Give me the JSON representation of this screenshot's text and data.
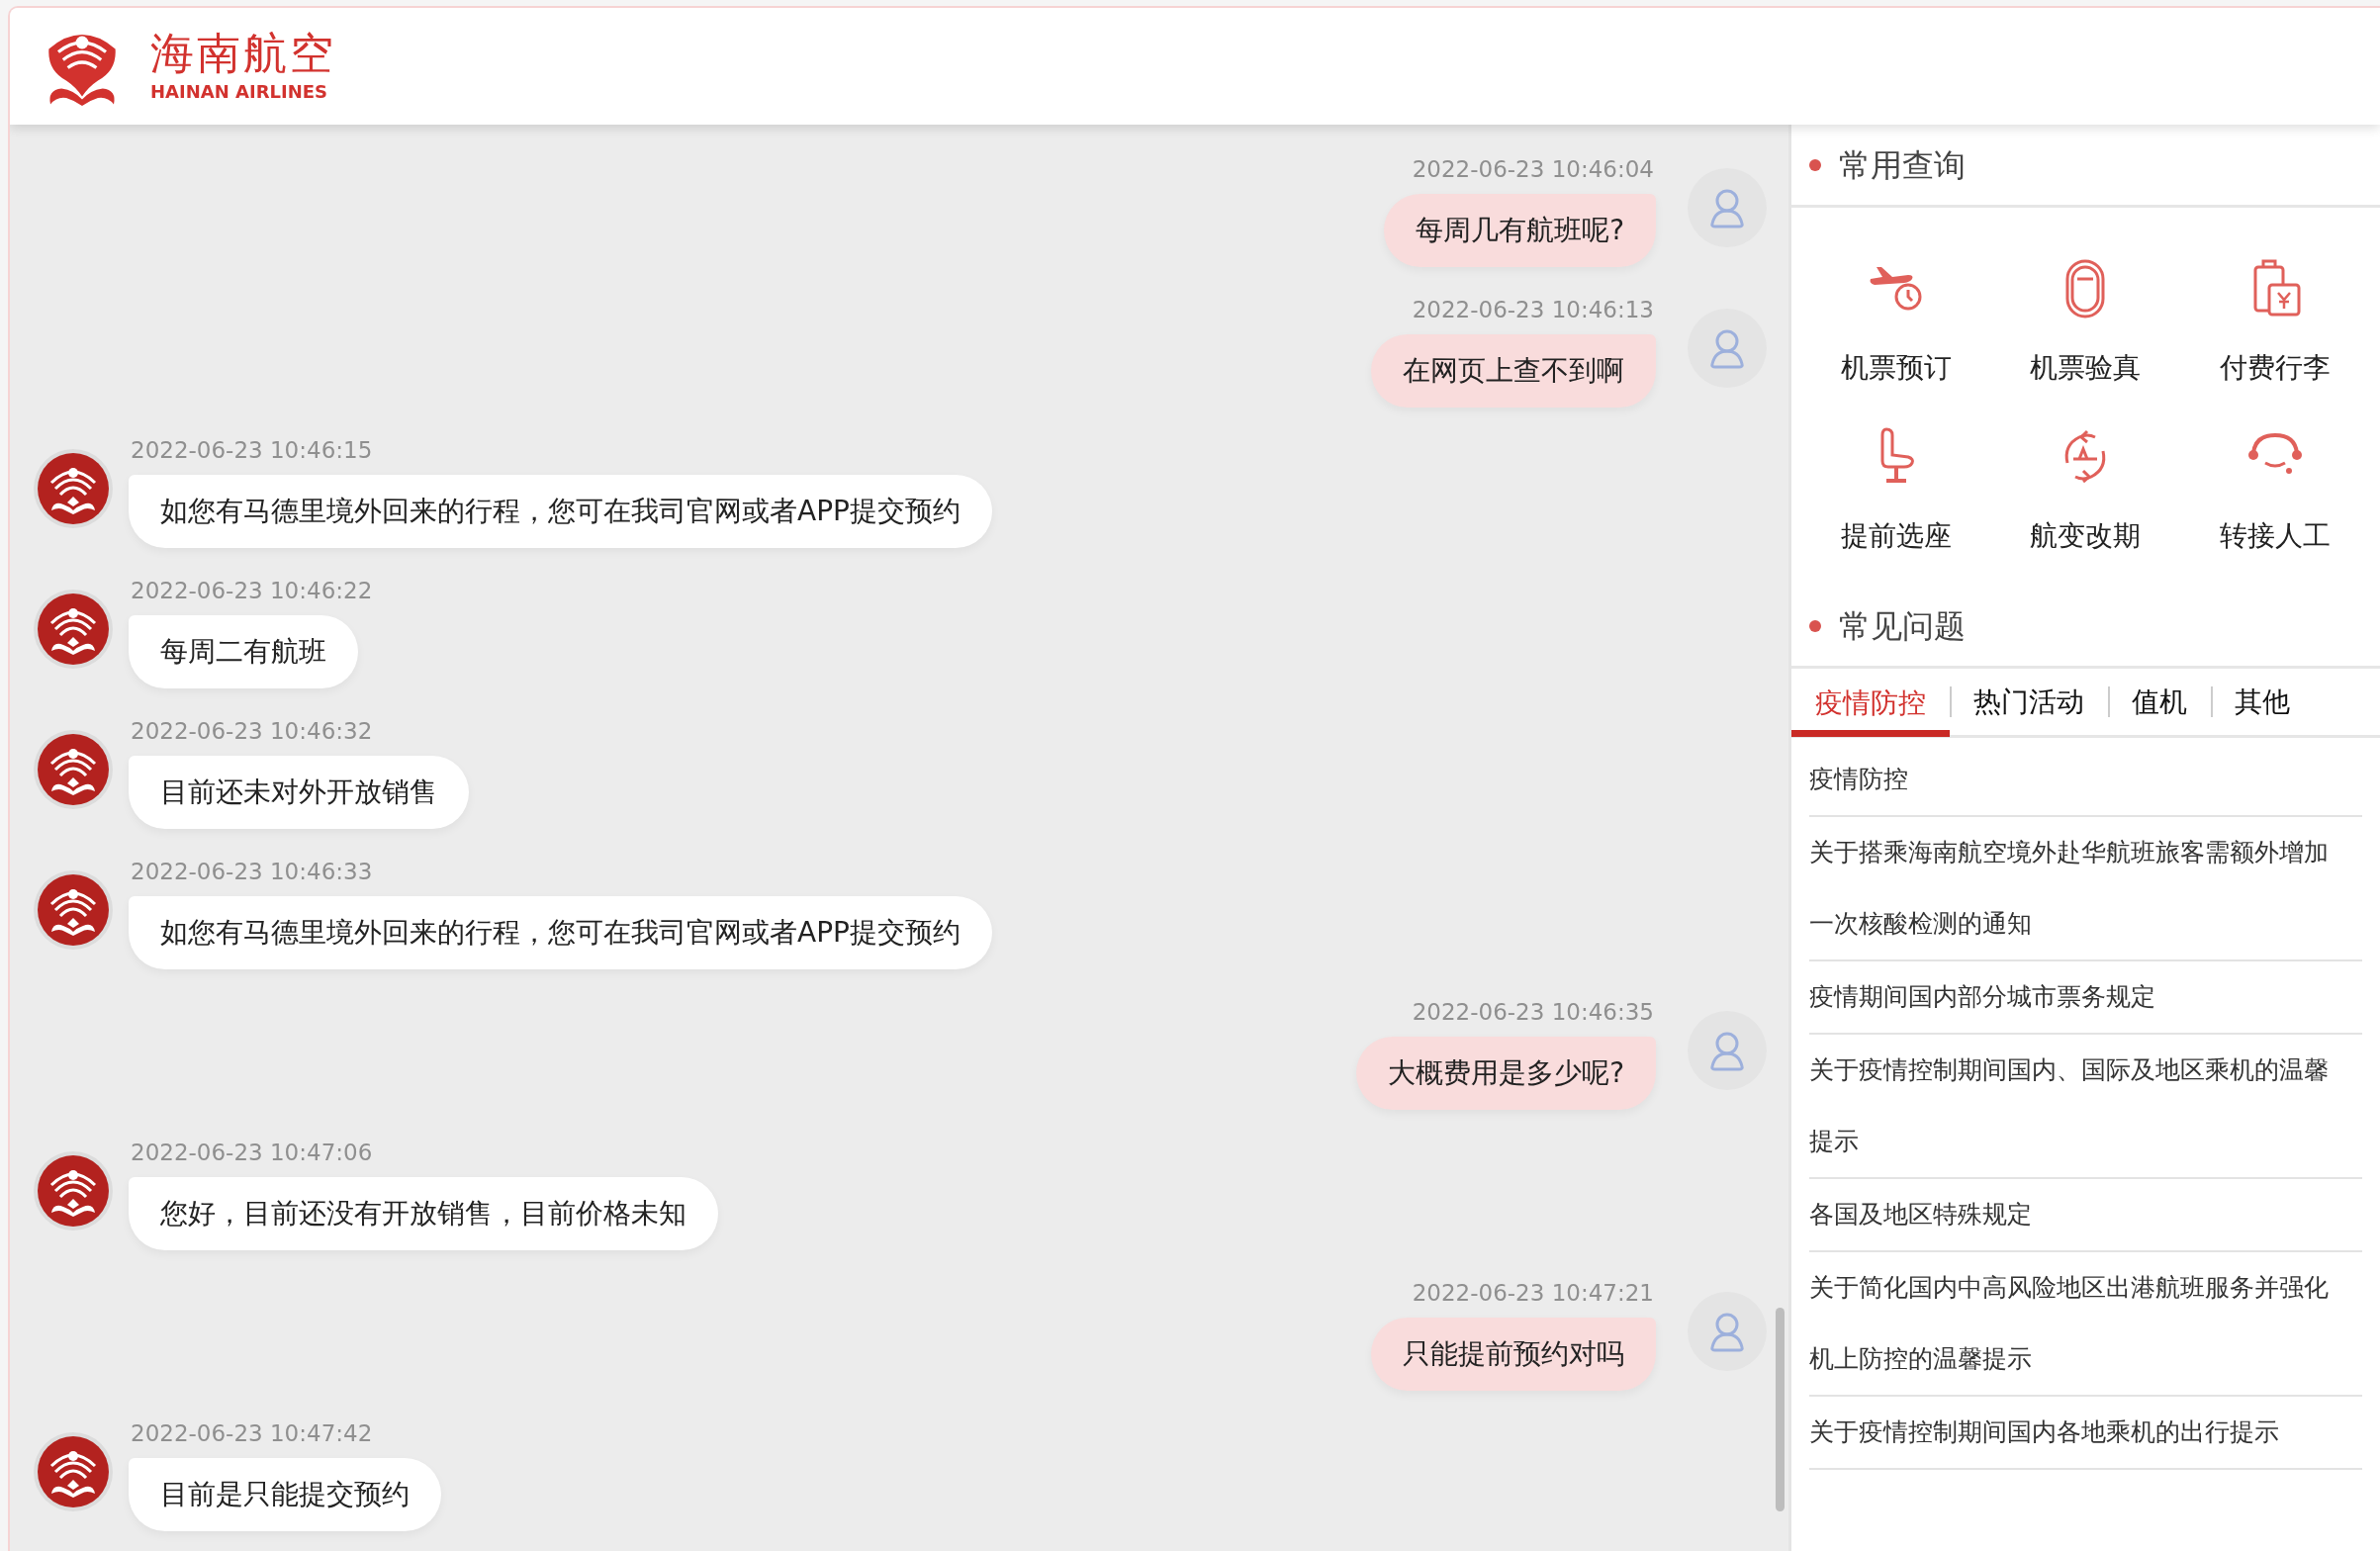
{
  "header": {
    "logo_title": "海南航空",
    "logo_subtitle": "HAINAN AIRLINES"
  },
  "messages": [
    {
      "kind": "user",
      "time": "2022-06-23 10:46:04",
      "text": "每周几有航班呢?"
    },
    {
      "kind": "user",
      "time": "2022-06-23 10:46:13",
      "text": "在网页上查不到啊"
    },
    {
      "kind": "bot",
      "time": "2022-06-23 10:46:15",
      "text": "如您有马德里境外回来的行程，您可在我司官网或者APP提交预约"
    },
    {
      "kind": "bot",
      "time": "2022-06-23 10:46:22",
      "text": "每周二有航班"
    },
    {
      "kind": "bot",
      "time": "2022-06-23 10:46:32",
      "text": "目前还未对外开放销售"
    },
    {
      "kind": "bot",
      "time": "2022-06-23 10:46:33",
      "text": "如您有马德里境外回来的行程，您可在我司官网或者APP提交预约"
    },
    {
      "kind": "user",
      "time": "2022-06-23 10:46:35",
      "text": "大概费用是多少呢?"
    },
    {
      "kind": "bot",
      "time": "2022-06-23 10:47:06",
      "text": "您好，目前还没有开放销售，目前价格未知"
    },
    {
      "kind": "user",
      "time": "2022-06-23 10:47:21",
      "text": "只能提前预约对吗"
    },
    {
      "kind": "bot",
      "time": "2022-06-23 10:47:42",
      "text": "目前是只能提交预约"
    }
  ],
  "quick_query": {
    "title": "常用查询",
    "items": [
      {
        "label": "机票预订"
      },
      {
        "label": "机票验真"
      },
      {
        "label": "付费行李"
      },
      {
        "label": "提前选座"
      },
      {
        "label": "航变改期"
      },
      {
        "label": "转接人工"
      }
    ]
  },
  "faq": {
    "title": "常见问题",
    "tabs": [
      {
        "label": "疫情防控",
        "selected": true
      },
      {
        "label": "热门活动",
        "selected": false
      },
      {
        "label": "值机",
        "selected": false
      },
      {
        "label": "其他",
        "selected": false
      }
    ],
    "items": [
      "疫情防控",
      "关于搭乘海南航空境外赴华航班旅客需额外增加一次核酸检测的通知",
      "疫情期间国内部分城市票务规定",
      "关于疫情控制期间国内、国际及地区乘机的温馨提示",
      "各国及地区特殊规定",
      "关于简化国内中高风险地区出港航班服务并强化机上防控的温馨提示",
      "关于疫情控制期间国内各地乘机的出行提示"
    ]
  }
}
